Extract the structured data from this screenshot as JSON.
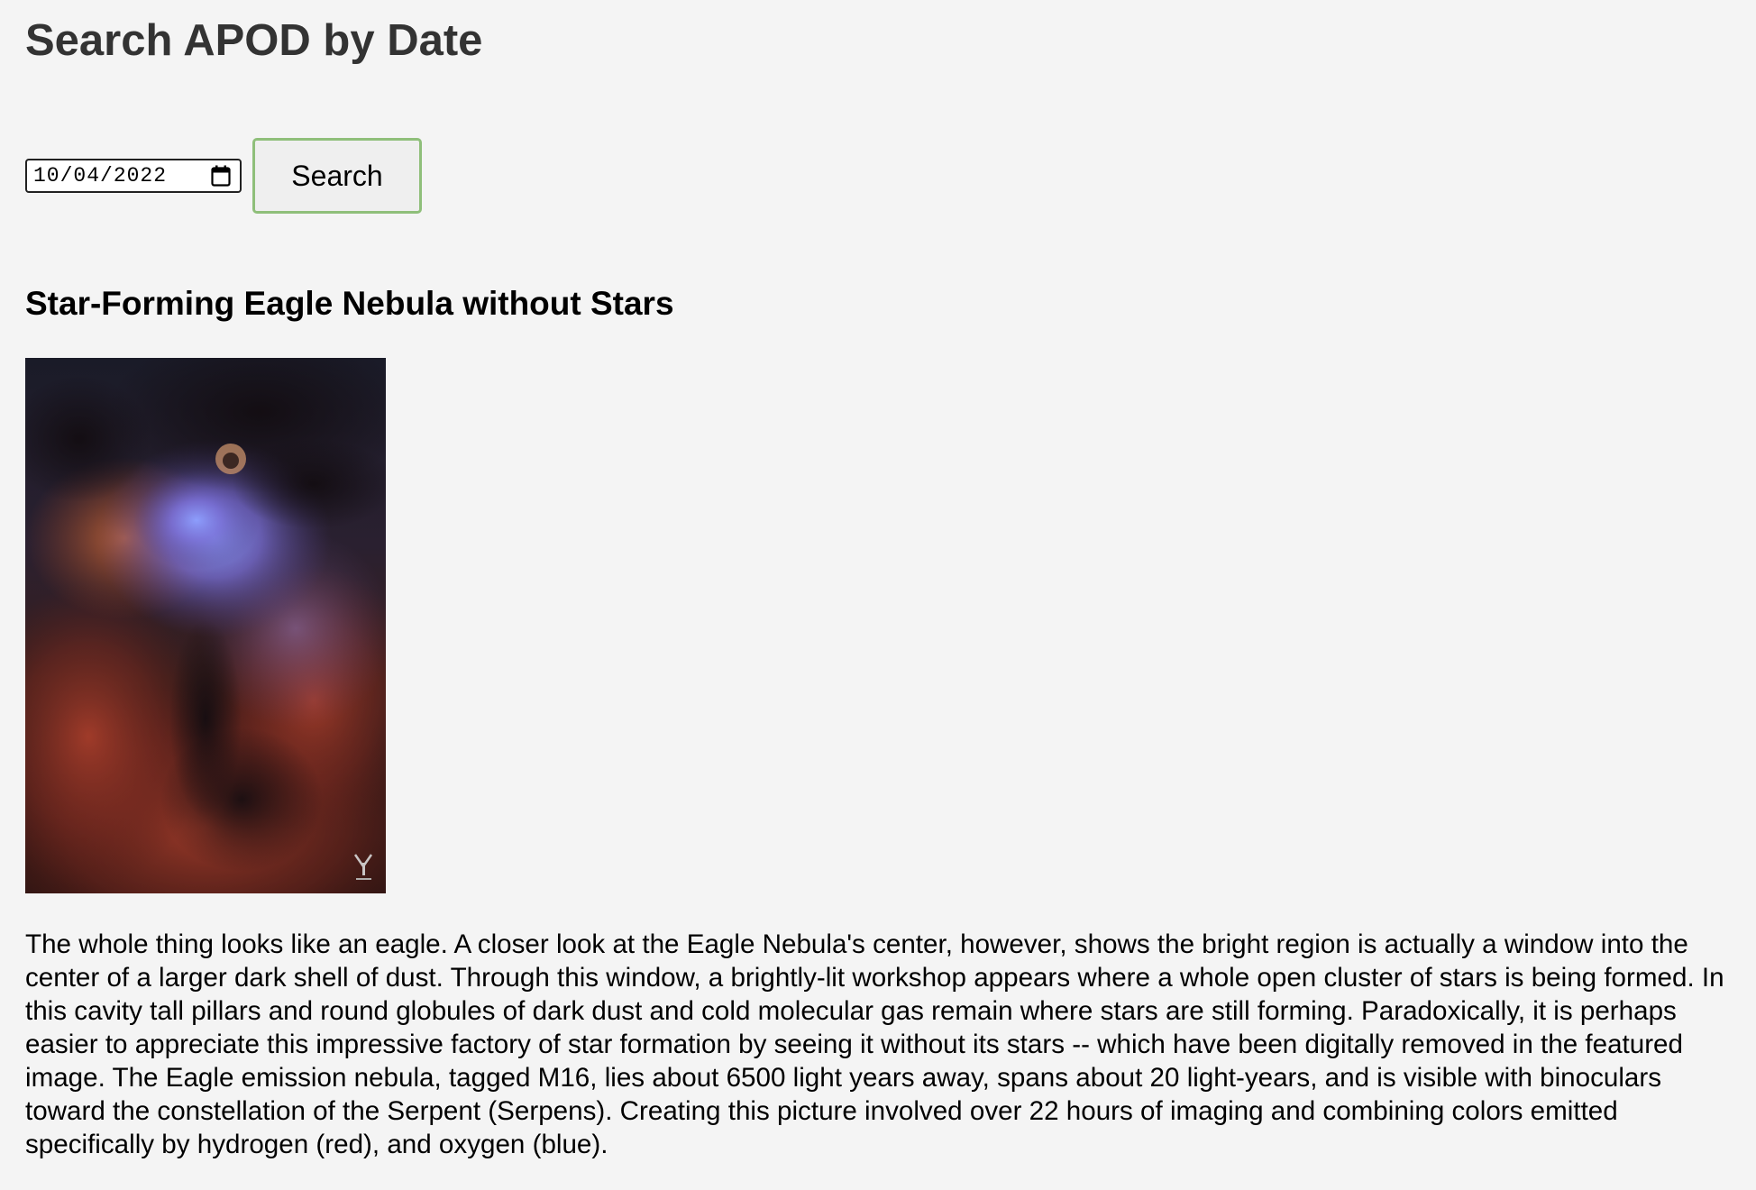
{
  "header": {
    "title": "Search APOD by Date"
  },
  "search": {
    "date_value": "10/04/2022",
    "button_label": "Search",
    "calendar_icon": "calendar-icon"
  },
  "apod": {
    "title": "Star-Forming Eagle Nebula without Stars",
    "image_description": "Eagle Nebula starless image with blue-violet core and red dust",
    "explanation": "The whole thing looks like an eagle. A closer look at the Eagle Nebula's center, however, shows the bright region is actually a window into the center of a larger dark shell of dust. Through this window, a brightly-lit workshop appears where a whole open cluster of stars is being formed. In this cavity tall pillars and round globules of dark dust and cold molecular gas remain where stars are still forming. Paradoxically, it is perhaps easier to appreciate this impressive factory of star formation by seeing it without its stars -- which have been digitally removed in the featured image. The Eagle emission nebula, tagged M16, lies about 6500 light years away, spans about 20 light-years, and is visible with binoculars toward the constellation of the Serpent (Serpens). Creating this picture involved over 22 hours of imaging and combining colors emitted specifically by hydrogen (red), and oxygen (blue)."
  },
  "colors": {
    "page_background": "#f4f4f4",
    "title_color": "#333333",
    "button_border": "#8fbf7a",
    "button_background": "#efefef"
  }
}
